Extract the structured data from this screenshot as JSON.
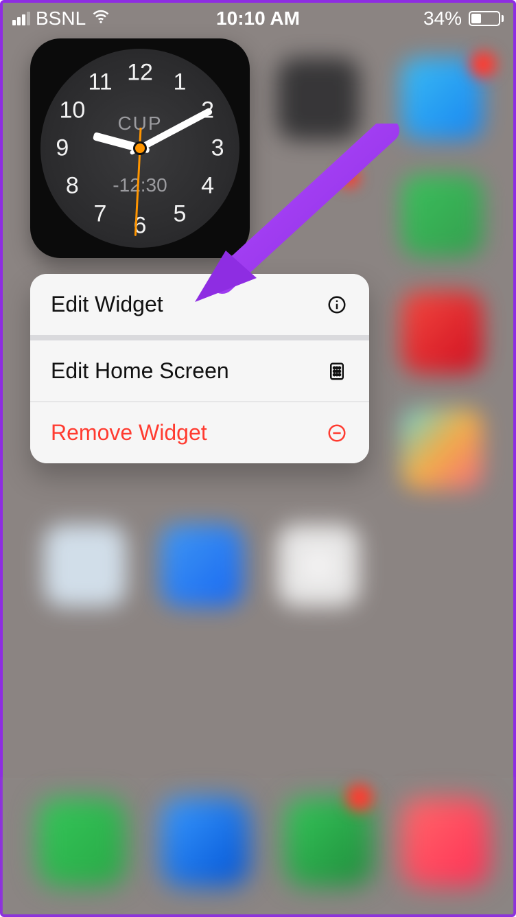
{
  "statusbar": {
    "carrier": "BSNL",
    "time": "10:10 AM",
    "battery_percent": "34%"
  },
  "clock": {
    "city": "CUP",
    "offset": "-12:30",
    "numbers": [
      "12",
      "1",
      "2",
      "3",
      "4",
      "5",
      "6",
      "7",
      "8",
      "9",
      "10",
      "11"
    ]
  },
  "menu": {
    "edit_widget": "Edit Widget",
    "edit_home": "Edit Home Screen",
    "remove_widget": "Remove Widget"
  },
  "colors": {
    "destructive": "#ff3b30",
    "accent_arrow": "#9b2ff0",
    "second_hand": "#ff9500"
  }
}
